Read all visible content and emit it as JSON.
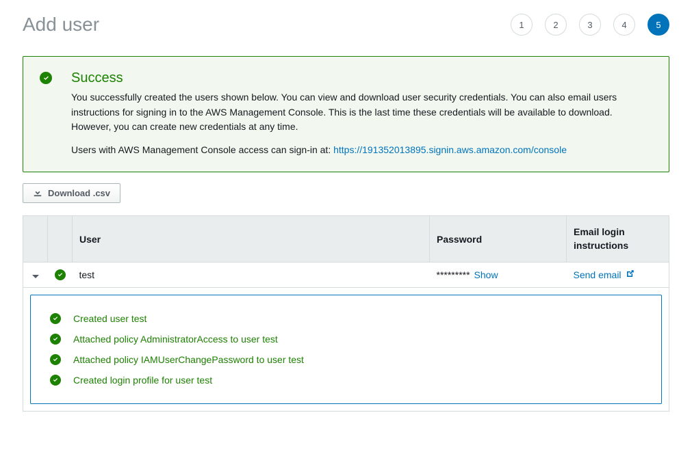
{
  "header": {
    "title": "Add user",
    "steps": [
      "1",
      "2",
      "3",
      "4",
      "5"
    ],
    "activeStep": 5
  },
  "success": {
    "title": "Success",
    "text": "You successfully created the users shown below. You can view and download user security credentials. You can also email users instructions for signing in to the AWS Management Console. This is the last time these credentials will be available to download. However, you can create new credentials at any time.",
    "signinPrefix": "Users with AWS Management Console access can sign-in at: ",
    "signinUrl": "https://191352013895.signin.aws.amazon.com/console"
  },
  "downloadButton": "Download .csv",
  "table": {
    "headers": {
      "user": "User",
      "password": "Password",
      "email": "Email login instructions"
    },
    "row": {
      "username": "test",
      "passwordMask": "*********",
      "showLabel": "Show",
      "sendEmail": "Send email"
    }
  },
  "details": {
    "items": [
      "Created user test",
      "Attached policy AdministratorAccess to user test",
      "Attached policy IAMUserChangePassword to user test",
      "Created login profile for user test"
    ]
  }
}
